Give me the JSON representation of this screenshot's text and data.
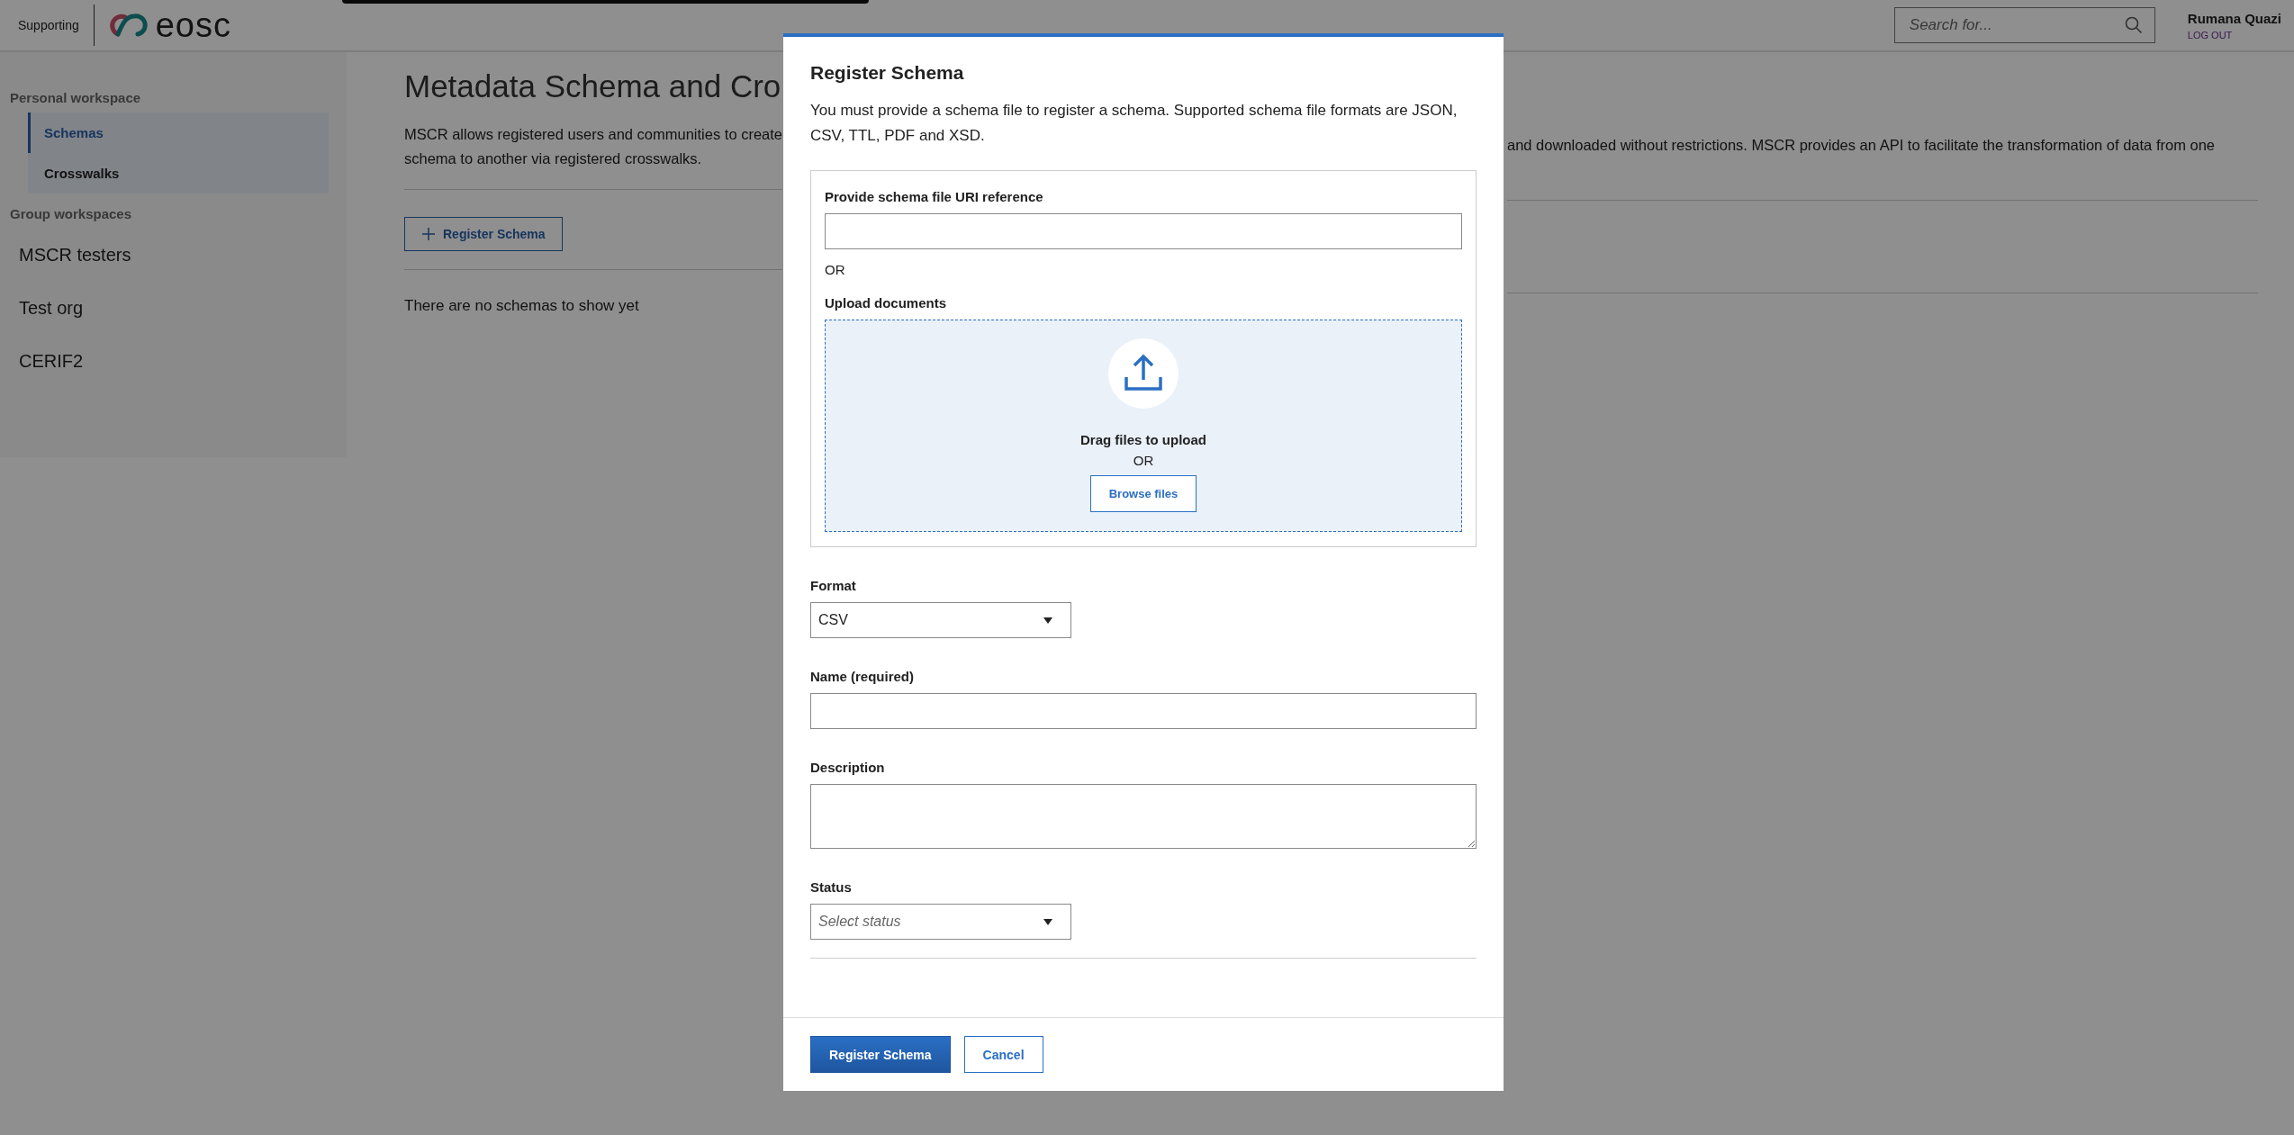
{
  "header": {
    "supporting_label": "Supporting",
    "logo_text": "eosc",
    "search": {
      "placeholder": "Search for..."
    },
    "user": {
      "name": "Rumana Quazi",
      "logout": "LOG OUT"
    }
  },
  "sidebar": {
    "sections": [
      {
        "kind": "personal",
        "title": "Personal workspace",
        "items": [
          {
            "label": "Schemas",
            "selected": true
          },
          {
            "label": "Crosswalks",
            "selected": false
          }
        ]
      },
      {
        "kind": "group",
        "title": "Group workspaces",
        "items": [
          {
            "label": "MSCR testers",
            "selected": false
          },
          {
            "label": "Test org",
            "selected": false
          },
          {
            "label": "CERIF2",
            "selected": false
          }
        ]
      }
    ]
  },
  "main": {
    "title": "Metadata Schema and Cro",
    "description_left": [
      "MSCR allows registered users and communities to create",
      "schema to another via registered crosswalks."
    ],
    "description_right": "and downloaded without restrictions. MSCR provides an API to facilitate the transformation of data from one",
    "register_button": "Register Schema",
    "empty_message": "There are no schemas to show yet"
  },
  "dialog": {
    "title": "Register Schema",
    "intro": "You must provide a schema file to register a schema. Supported schema file formats are JSON, CSV, TTL, PDF and XSD.",
    "uri_label": "Provide schema file URI reference",
    "or_text": "OR",
    "upload_label": "Upload documents",
    "drop_text": "Drag files to upload",
    "drop_or": "OR",
    "browse_button": "Browse files",
    "format": {
      "label": "Format",
      "value": "CSV"
    },
    "name": {
      "label": "Name (required)"
    },
    "description": {
      "label": "Description"
    },
    "status": {
      "label": "Status",
      "placeholder": "Select status"
    },
    "buttons": [
      {
        "kind": "primary",
        "label": "Register Schema"
      },
      {
        "kind": "secondary",
        "label": "Cancel"
      }
    ]
  }
}
